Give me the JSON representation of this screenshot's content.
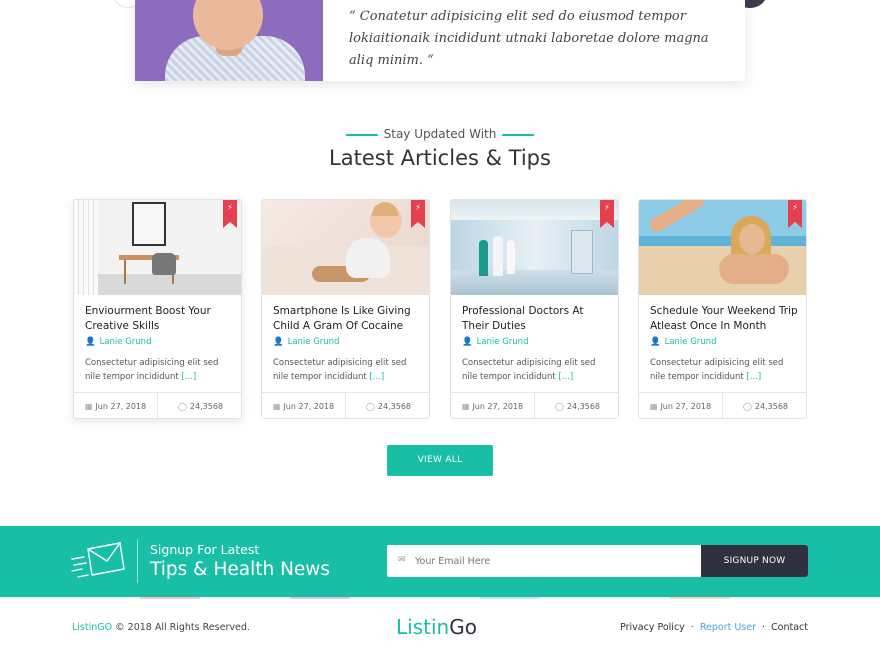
{
  "testimonial": {
    "quote": "“ Conatetur adipisicing elit sed do eiusmod tempor lokiaitionaik incididunt utnaki laboretae dolore magna aliq minim. “"
  },
  "section": {
    "kicker": "Stay Updated With",
    "title": "Latest Articles & Tips"
  },
  "articles": [
    {
      "title": "Enviourment Boost Your Creative Skills",
      "author": "Lanie Grund",
      "excerpt": "Consectetur adipisicing elit sed nile tempor incididunt",
      "more": "[...]",
      "date": "Jun 27, 2018",
      "comments": "24,3568"
    },
    {
      "title": "Smartphone Is Like Giving Child A Gram Of Cocaine",
      "author": "Lanie Grund",
      "excerpt": "Consectetur adipisicing elit sed nile tempor incididunt",
      "more": "[...]",
      "date": "Jun 27, 2018",
      "comments": "24,3568"
    },
    {
      "title": "Professional Doctors At  Their Duties",
      "author": "Lanie Grund",
      "excerpt": "Consectetur adipisicing elit sed nile tempor incididunt",
      "more": "[...]",
      "date": "Jun 27, 2018",
      "comments": "24,3568"
    },
    {
      "title": "Schedule Your Weekend Trip Atleast Once In Month",
      "author": "Lanie Grund",
      "excerpt": "Consectetur adipisicing elit sed nile tempor incididunt",
      "more": "[...]",
      "date": "Jun 27, 2018",
      "comments": "24,3568"
    }
  ],
  "view_all_label": "VIEW ALL",
  "newsletter": {
    "kicker": "Signup For Latest",
    "title": "Tips & Health News",
    "placeholder": "Your Email Here",
    "button": "SIGNUP NOW"
  },
  "footer": {
    "brand": "ListinGO",
    "copyright": " © 2018 All Rights Reserved.",
    "logo_part1": "Listin",
    "logo_part2": "Go",
    "links": [
      "Privacy Policy",
      "Report User",
      "Contact"
    ]
  },
  "colors": {
    "accent": "#18bfa5",
    "dark": "#2f323e",
    "bookmark": "#e6404e",
    "link_active": "#4aa3df"
  },
  "icons": {
    "bookmark": "bookmark-icon",
    "author": "user-icon",
    "date": "calendar-icon",
    "comments": "comment-icon",
    "mail": "mail-icon",
    "email_field": "envelope-icon"
  }
}
